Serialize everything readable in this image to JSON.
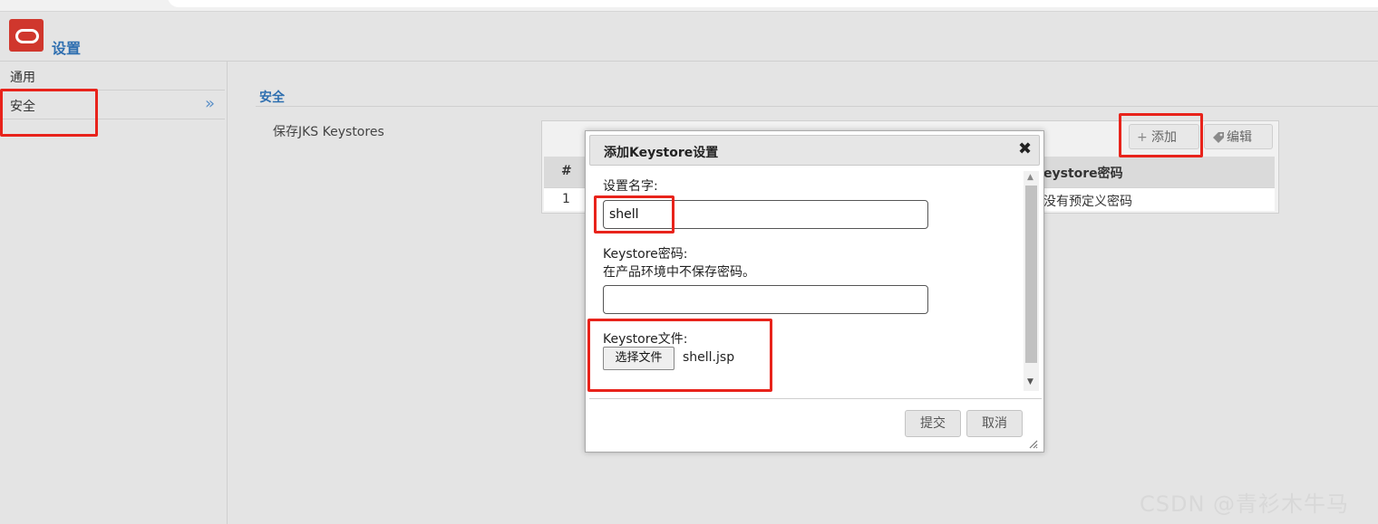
{
  "header": {
    "title": "设置",
    "logo_icon": "oracle-logo"
  },
  "sidebar": {
    "items": [
      {
        "label": "通用"
      },
      {
        "label": "安全",
        "chevron": "»"
      }
    ]
  },
  "main": {
    "section_title": "安全",
    "keystore_label": "保存JKS Keystores",
    "toolbar": {
      "add_label": "添加",
      "edit_label": "编辑"
    },
    "table": {
      "headers": [
        "#",
        "eystore密码"
      ],
      "rows": [
        {
          "index": "1",
          "password": "没有预定义密码"
        }
      ]
    }
  },
  "dialog": {
    "title": "添加Keystore设置",
    "close": "✖",
    "name_label": "设置名字:",
    "name_value": "shell",
    "password_label": "Keystore密码:",
    "password_hint": "在产品环境中不保存密码。",
    "password_value": "",
    "file_label": "Keystore文件:",
    "file_button": "选择文件",
    "file_name": "shell.jsp",
    "submit_label": "提交",
    "cancel_label": "取消"
  },
  "watermark": "CSDN @青衫木牛马",
  "colors": {
    "accent": "#2f6fb0",
    "highlight": "#e8231b",
    "logo": "#d0372d"
  }
}
